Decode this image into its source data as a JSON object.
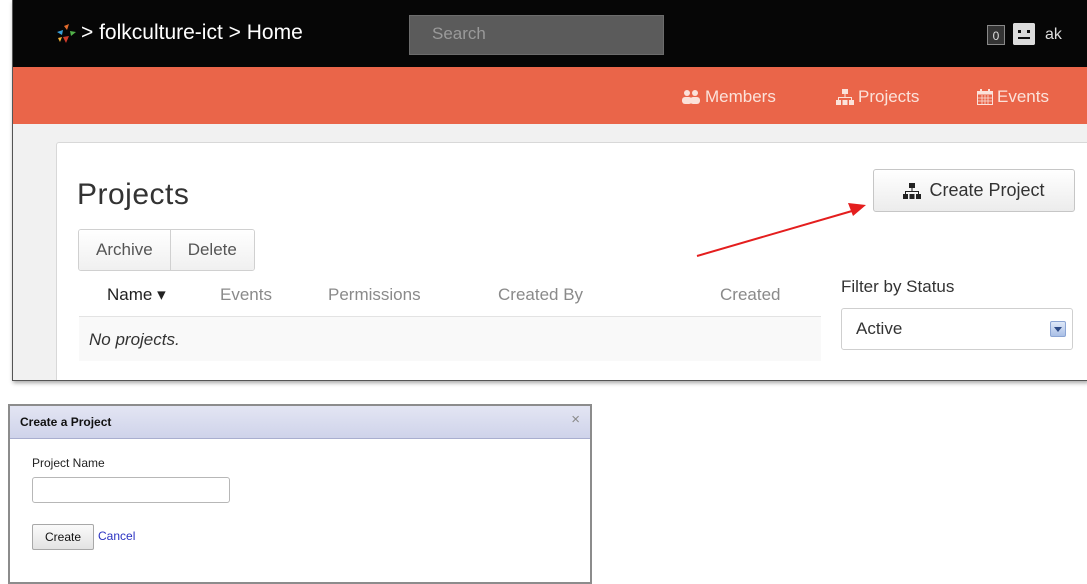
{
  "topbar": {
    "breadcrumb": [
      "> folkculture-ict",
      "> Home"
    ],
    "search_placeholder": "Search",
    "notification_count": "0",
    "username": "ak"
  },
  "nav": {
    "members": "Members",
    "projects": "Projects",
    "events": "Events"
  },
  "projects_page": {
    "title": "Projects",
    "create_button": "Create Project",
    "actions": [
      "Archive",
      "Delete"
    ],
    "columns": {
      "name": "Name ▾",
      "events": "Events",
      "permissions": "Permissions",
      "created_by": "Created By",
      "created": "Created"
    },
    "empty_message": "No projects.",
    "filter_label": "Filter by Status",
    "filter_value": "Active"
  },
  "dialog": {
    "title": "Create a Project",
    "close": "×",
    "field_label": "Project Name",
    "field_value": "",
    "create_button": "Create",
    "cancel_link": "Cancel"
  },
  "colors": {
    "topbar": "#060606",
    "navbar": "#ea6549",
    "annotation_arrow": "#e41e1e",
    "dialog_header": "#d6daee",
    "link": "#2a32c2"
  }
}
